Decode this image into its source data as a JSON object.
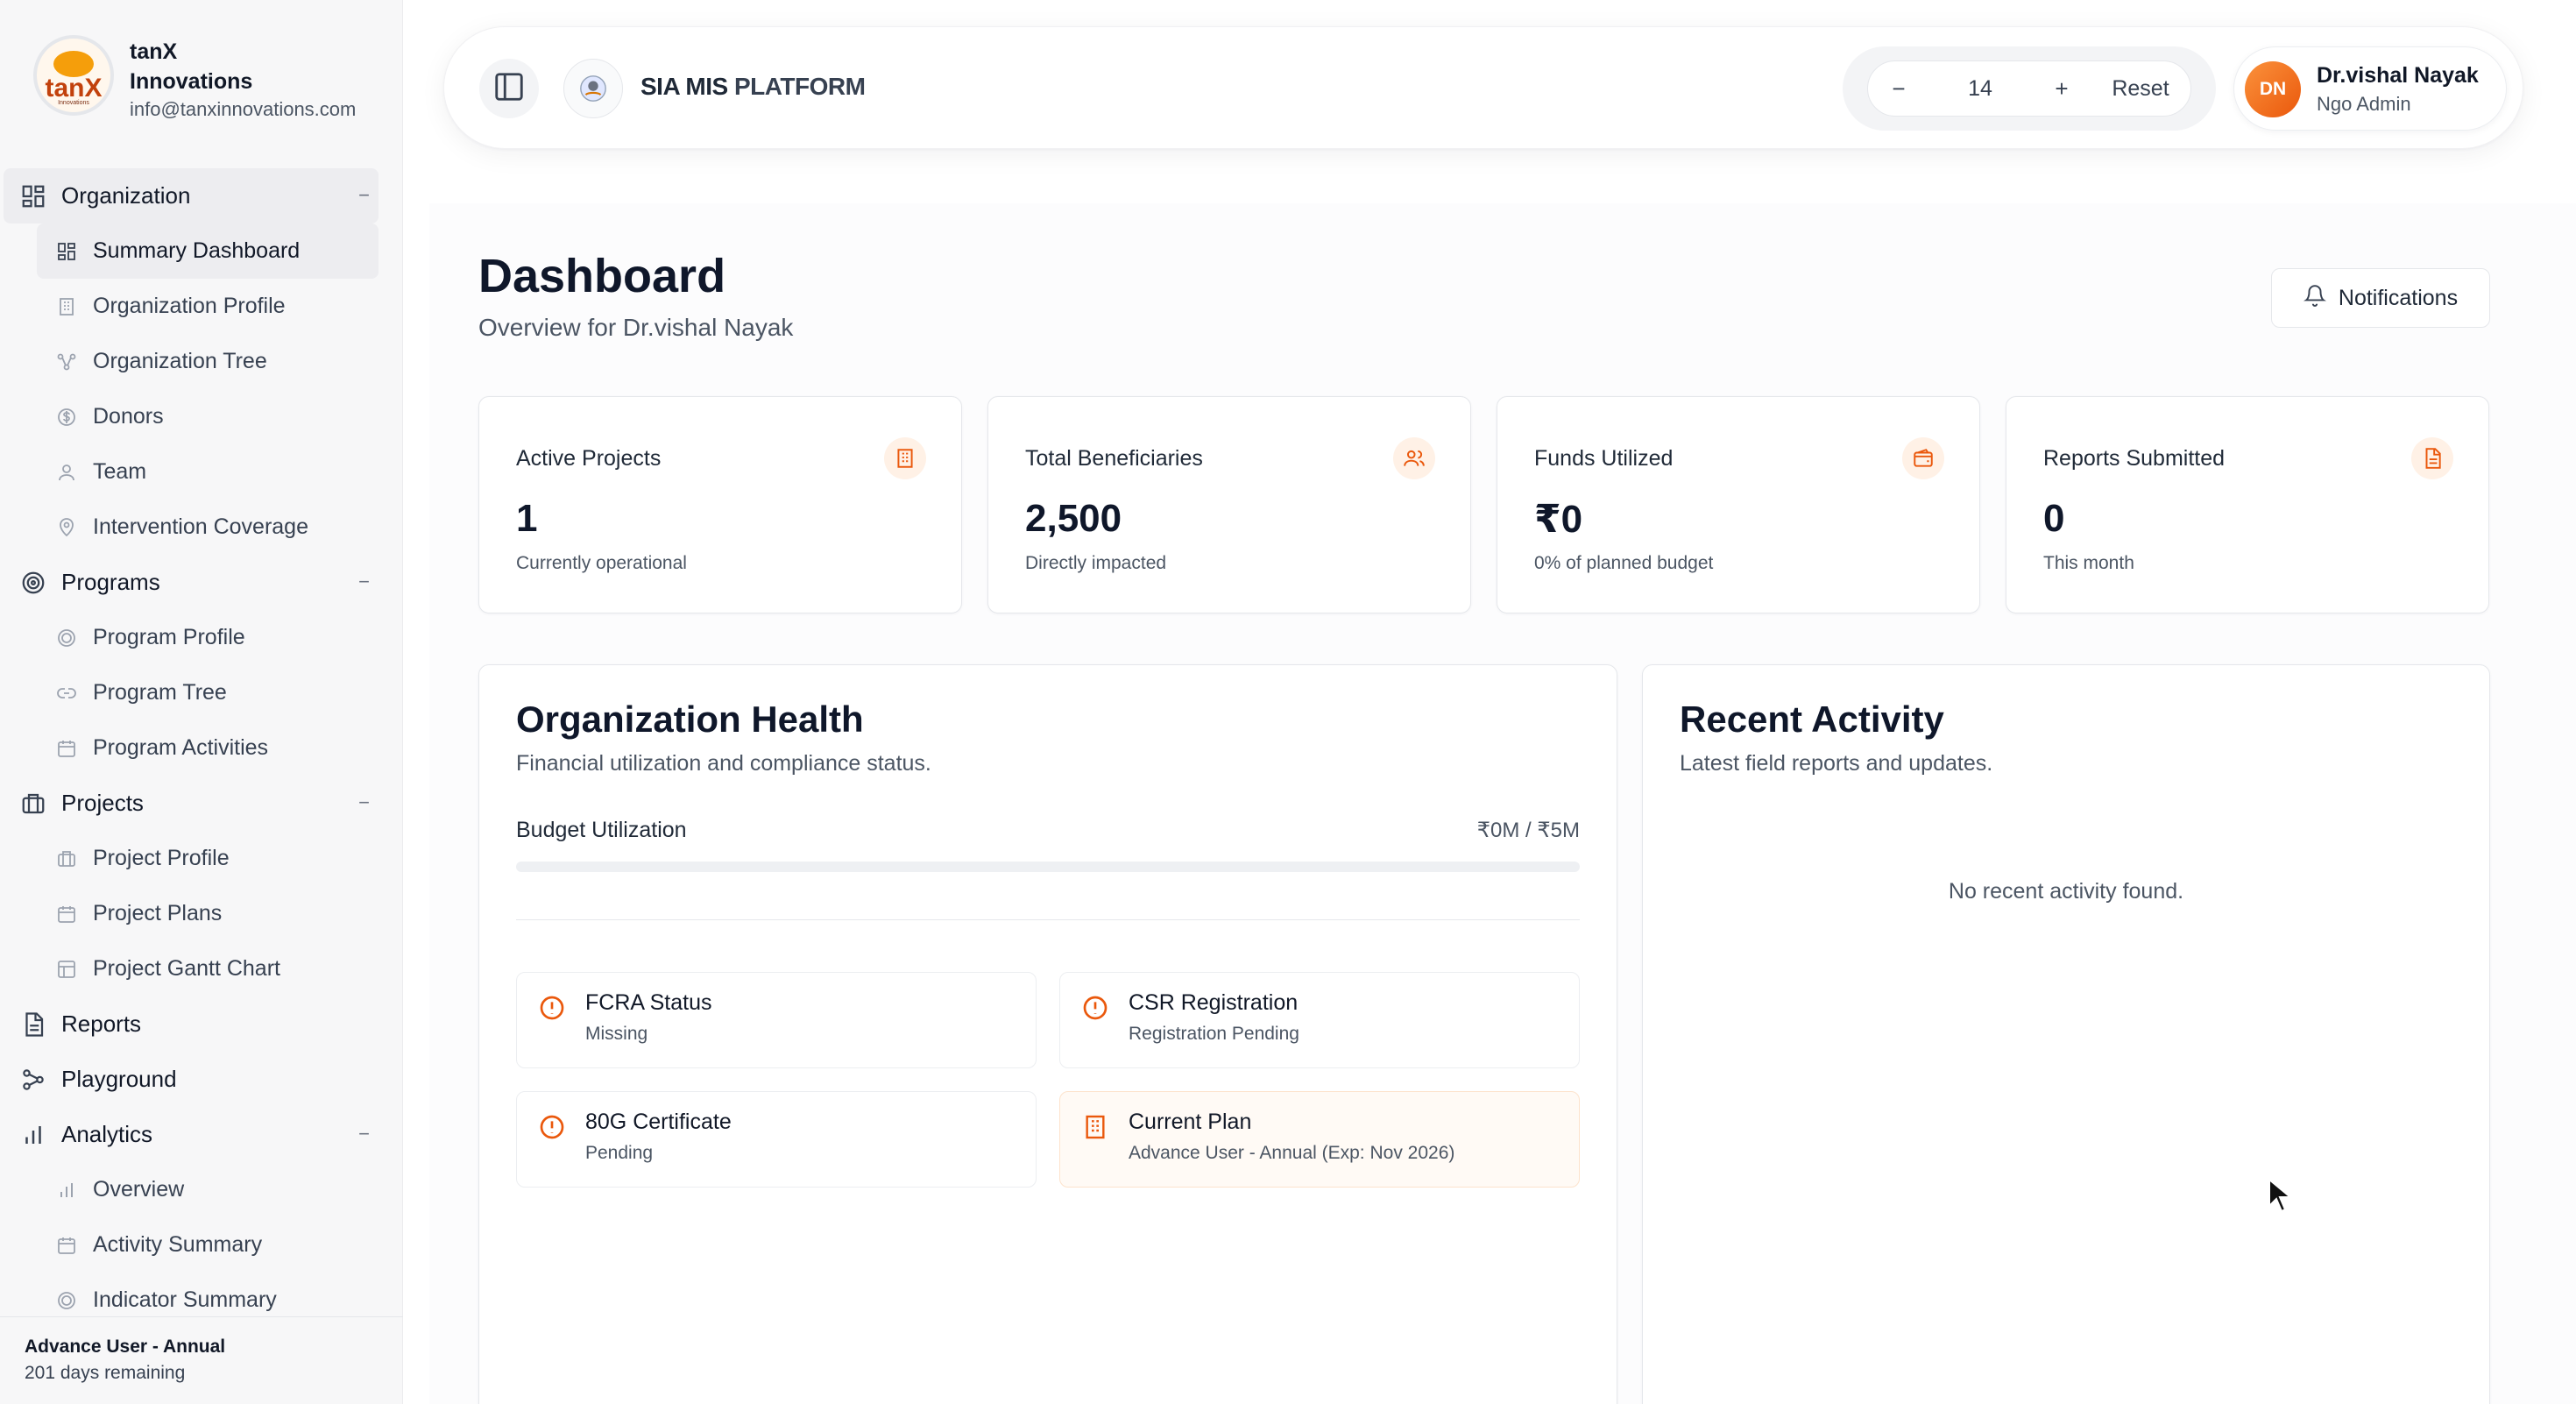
{
  "org": {
    "name_line1": "tanX",
    "name_line2": "Innovations",
    "email": "info@tanxinnovations.com",
    "logo_word": "tanX",
    "logo_sub": "Innovations"
  },
  "sidebar": {
    "sections": [
      {
        "label": "Organization",
        "icon": "grid-icon",
        "items": [
          {
            "label": "Summary Dashboard",
            "icon": "dashboard-icon",
            "selected": true
          },
          {
            "label": "Organization Profile",
            "icon": "building-icon"
          },
          {
            "label": "Organization Tree",
            "icon": "tree-icon"
          },
          {
            "label": "Donors",
            "icon": "dollar-icon"
          },
          {
            "label": "Team",
            "icon": "user-icon"
          },
          {
            "label": "Intervention Coverage",
            "icon": "location-icon"
          }
        ]
      },
      {
        "label": "Programs",
        "icon": "target-icon",
        "items": [
          {
            "label": "Program Profile",
            "icon": "target-icon"
          },
          {
            "label": "Program Tree",
            "icon": "link-icon"
          },
          {
            "label": "Program Activities",
            "icon": "calendar-icon"
          }
        ]
      },
      {
        "label": "Projects",
        "icon": "briefcase-icon",
        "items": [
          {
            "label": "Project Profile",
            "icon": "briefcase-icon"
          },
          {
            "label": "Project Plans",
            "icon": "calendar-icon"
          },
          {
            "label": "Project Gantt Chart",
            "icon": "table-icon"
          }
        ]
      },
      {
        "label": "Reports",
        "icon": "document-icon",
        "items": []
      },
      {
        "label": "Playground",
        "icon": "workflow-icon",
        "items": []
      },
      {
        "label": "Analytics",
        "icon": "bar-chart-icon",
        "items": [
          {
            "label": "Overview",
            "icon": "bar-chart-icon"
          },
          {
            "label": "Activity Summary",
            "icon": "calendar-icon"
          },
          {
            "label": "Indicator Summary",
            "icon": "target-icon"
          }
        ]
      }
    ],
    "plan": {
      "title": "Advance User - Annual",
      "days": "201 days remaining"
    }
  },
  "header": {
    "platform_bold": "SIA MIS",
    "platform_rest": "PLATFORM",
    "font_size": {
      "minus": "−",
      "value": "14",
      "plus": "+",
      "reset": "Reset"
    },
    "user": {
      "initials": "DN",
      "name": "Dr.vishal Nayak",
      "role": "Ngo Admin"
    }
  },
  "dashboard": {
    "title": "Dashboard",
    "subtitle": "Overview for Dr.vishal Nayak",
    "notifications_label": "Notifications",
    "stats": [
      {
        "label": "Active Projects",
        "value": "1",
        "note": "Currently operational",
        "icon": "building-icon"
      },
      {
        "label": "Total Beneficiaries",
        "value": "2,500",
        "note": "Directly impacted",
        "icon": "users-icon"
      },
      {
        "label": "Funds Utilized",
        "value": "₹0",
        "note": "0% of planned budget",
        "icon": "wallet-icon"
      },
      {
        "label": "Reports Submitted",
        "value": "0",
        "note": "This month",
        "icon": "document-icon"
      }
    ],
    "health": {
      "title": "Organization Health",
      "subtitle": "Financial utilization and compliance status.",
      "budget_label": "Budget Utilization",
      "budget_value": "₹0M / ₹5M",
      "budget_fraction": 0.0,
      "tiles": [
        {
          "title": "FCRA Status",
          "sub": "Missing",
          "icon": "alert-circle-icon"
        },
        {
          "title": "CSR Registration",
          "sub": "Registration Pending",
          "icon": "alert-circle-icon"
        },
        {
          "title": "80G Certificate",
          "sub": "Pending",
          "icon": "alert-circle-icon"
        },
        {
          "title": "Current Plan",
          "sub": "Advance User - Annual (Exp: Nov 2026)",
          "icon": "building-icon"
        }
      ]
    },
    "activity": {
      "title": "Recent Activity",
      "subtitle": "Latest field reports and updates.",
      "empty": "No recent activity found."
    }
  },
  "colors": {
    "accent": "#ea580c",
    "accent_soft": "#fff1e6",
    "text": "#0f172a",
    "muted": "#4b5563"
  }
}
